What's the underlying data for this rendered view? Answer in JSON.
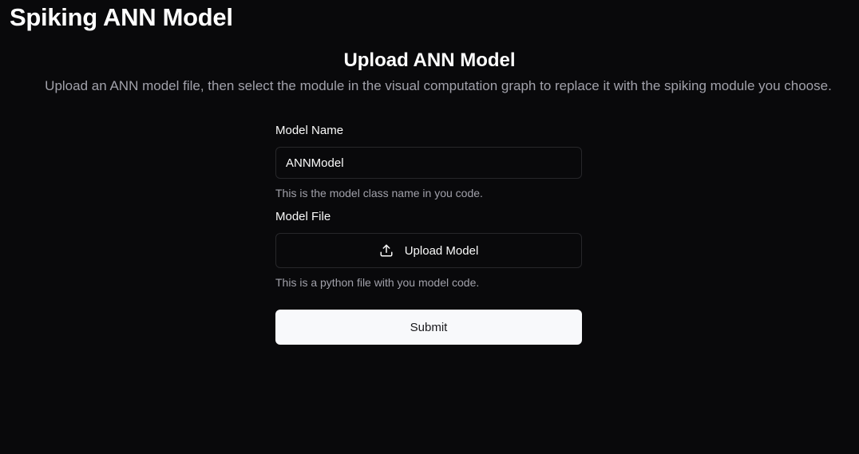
{
  "app": {
    "title": "Spiking ANN Model"
  },
  "section": {
    "title": "Upload ANN Model",
    "description": "Upload an ANN model file, then select the module in the visual computation graph to replace it with the spiking module you choose."
  },
  "form": {
    "model_name": {
      "label": "Model Name",
      "value": "ANNModel",
      "hint": "This is the model class name in you code."
    },
    "model_file": {
      "label": "Model File",
      "button_label": "Upload Model",
      "button_icon": "upload-icon",
      "hint": "This is a python file with you model code."
    },
    "submit_label": "Submit"
  },
  "colors": {
    "background": "#09090b",
    "border": "#27272a",
    "muted_text": "#a1a1aa",
    "primary_button": "#f8f9fb"
  }
}
